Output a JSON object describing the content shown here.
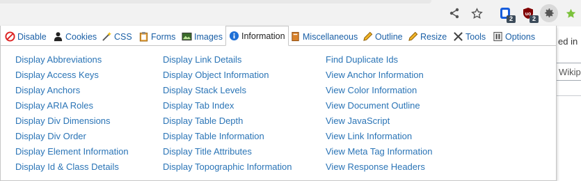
{
  "browser": {
    "badges": {
      "ext1": "2",
      "ext2": "2"
    }
  },
  "page_behind": {
    "fragment_text": "ed in",
    "search_fragment": "Wikipe"
  },
  "popup": {
    "tabs": [
      {
        "label": "Disable",
        "icon": "disable-icon"
      },
      {
        "label": "Cookies",
        "icon": "cookies-icon"
      },
      {
        "label": "CSS",
        "icon": "css-wand-icon"
      },
      {
        "label": "Forms",
        "icon": "forms-clipboard-icon"
      },
      {
        "label": "Images",
        "icon": "images-icon"
      },
      {
        "label": "Information",
        "icon": "info-icon",
        "active": true
      },
      {
        "label": "Miscellaneous",
        "icon": "misc-book-icon"
      },
      {
        "label": "Outline",
        "icon": "outline-pencil-icon"
      },
      {
        "label": "Resize",
        "icon": "resize-pencil-icon"
      },
      {
        "label": "Tools",
        "icon": "tools-icon"
      },
      {
        "label": "Options",
        "icon": "options-icon"
      }
    ],
    "columns": [
      [
        "Display Abbreviations",
        "Display Access Keys",
        "Display Anchors",
        "Display ARIA Roles",
        "Display Div Dimensions",
        "Display Div Order",
        "Display Element Information",
        "Display Id & Class Details"
      ],
      [
        "Display Link Details",
        "Display Object Information",
        "Display Stack Levels",
        "Display Tab Index",
        "Display Table Depth",
        "Display Table Information",
        "Display Title Attributes",
        "Display Topographic Information"
      ],
      [
        "Find Duplicate Ids",
        "View Anchor Information",
        "View Color Information",
        "View Document Outline",
        "View JavaScript",
        "View Link Information",
        "View Meta Tag Information",
        "View Response Headers"
      ]
    ]
  },
  "colors": {
    "link": "#2a74b6",
    "tab_text": "#1a5fa6"
  }
}
